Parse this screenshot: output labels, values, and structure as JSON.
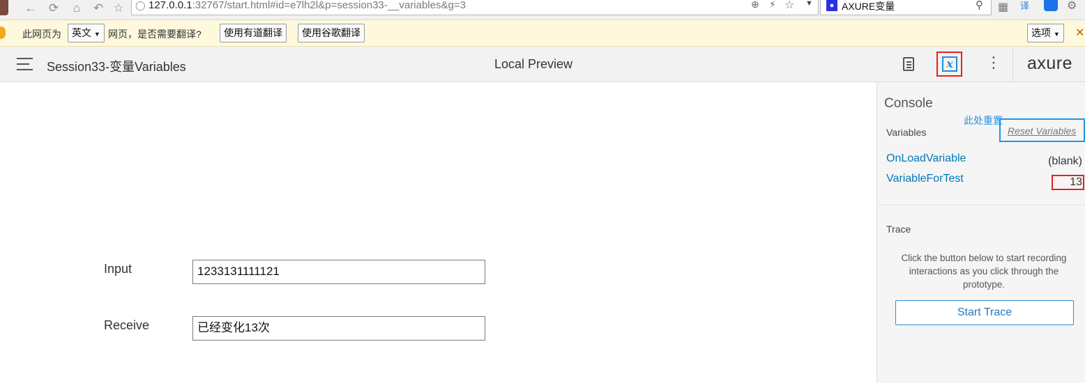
{
  "browser": {
    "url_host": "127.0.0.1",
    "url_rest": ":32767/start.html#id=e7lh2l&p=session33-__variables&g=3",
    "search_text": "AXURE变量"
  },
  "translate_bar": {
    "prefix": "此网页为",
    "language": "英文",
    "question": "网页，是否需要翻译?",
    "youdao_button": "使用有道翻译",
    "google_button": "使用谷歌翻译",
    "options_button": "选项"
  },
  "header": {
    "project_title": "Session33-变量Variables",
    "page_name": "Local Preview",
    "logo": "axure"
  },
  "form": {
    "input_label": "Input",
    "input_value": "1233131111121",
    "receive_label": "Receive",
    "receive_value": "已经变化13次"
  },
  "console": {
    "title": "Console",
    "variables_label": "Variables",
    "annotation": "此处重置",
    "reset_link": "Reset Variables",
    "variables": [
      {
        "name": "OnLoadVariable",
        "value": "(blank)"
      },
      {
        "name": "VariableForTest",
        "value": "13"
      }
    ],
    "trace_label": "Trace",
    "trace_help": "Click the button below to start recording interactions as you click through the prototype.",
    "start_trace_button": "Start Trace"
  },
  "colors": {
    "highlight_red": "#e8201e",
    "highlight_blue": "#1e96e6",
    "variable_blue": "#0078b8",
    "translate_bar_bg": "#fef9dc"
  },
  "icons": [
    "back-icon",
    "refresh-icon",
    "home-icon",
    "undo-icon",
    "star-icon",
    "shield-icon",
    "zoom-icon",
    "lightning-icon",
    "dropdown-icon",
    "baidu-paw-icon",
    "search-icon",
    "grid-icon",
    "translate-icon",
    "bookmark-icon",
    "wrench-icon",
    "close-icon",
    "hamburger-icon",
    "document-icon",
    "variable-x-icon",
    "kebab-icon"
  ]
}
